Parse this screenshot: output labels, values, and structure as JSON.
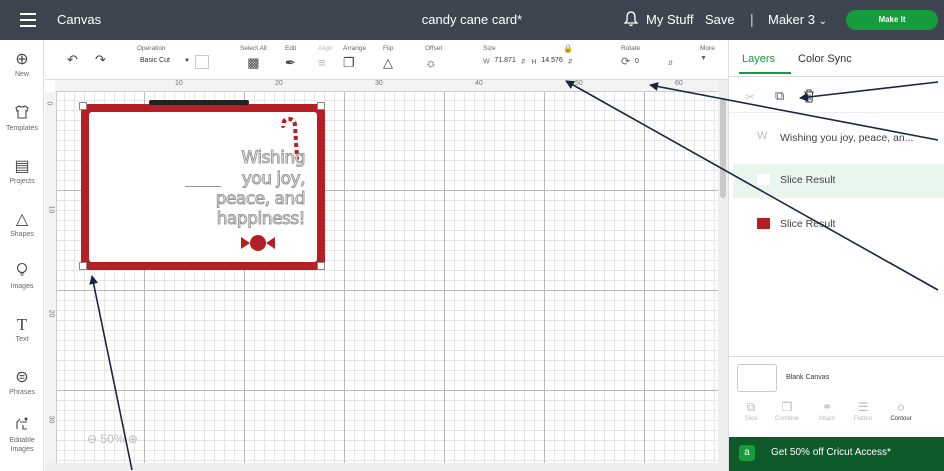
{
  "header": {
    "app_title": "Canvas",
    "doc_title": "candy cane card*",
    "my_stuff": "My Stuff",
    "save": "Save",
    "separator": "|",
    "machine": "Maker 3",
    "make_it": "Make It"
  },
  "sidebar": {
    "items": [
      {
        "icon": "⊕",
        "label": "New"
      },
      {
        "icon": "👕",
        "label": "Templates"
      },
      {
        "icon": "▤",
        "label": "Projects"
      },
      {
        "icon": "△",
        "label": "Shapes"
      },
      {
        "icon": "⚲",
        "label": "Images"
      },
      {
        "icon": "T",
        "label": "Text"
      },
      {
        "icon": "⊜",
        "label": "Phrases"
      },
      {
        "icon": "⬚",
        "label": "Editable Images"
      }
    ]
  },
  "toolbar": {
    "operation_label": "Operation",
    "operation_value": "Basic Cut",
    "select_all_label": "Select All",
    "edit_label": "Edit",
    "align_label": "Align",
    "arrange_label": "Arrange",
    "flip_label": "Flip",
    "offset_label": "Offset",
    "size_label": "Size",
    "width_prefix": "W",
    "width_value": "71.871",
    "height_prefix": "H",
    "height_value": "14.576",
    "rotate_label": "Rotate",
    "rotate_value": "0",
    "more_label": "More"
  },
  "ruler": {
    "top": [
      "10",
      "20",
      "30",
      "40",
      "50",
      "60"
    ],
    "left": [
      "0",
      "10",
      "20",
      "30"
    ]
  },
  "card": {
    "lines": [
      "Wishing",
      "you joy,",
      "peace, and",
      "happiness!"
    ]
  },
  "zoom": {
    "label": "50%"
  },
  "panel": {
    "tabs": [
      "Layers",
      "Color Sync"
    ],
    "layers": [
      {
        "label": "Wishing you joy, peace, an..."
      },
      {
        "label": "Slice Result"
      },
      {
        "label": "Slice Result"
      }
    ],
    "blank_canvas": "Blank Canvas",
    "tools": [
      "Slice",
      "Combine",
      "Attach",
      "Flatten",
      "Contour"
    ],
    "promo": "Get 50% off Cricut Access*"
  },
  "colors": {
    "header_bg": "#3d4650",
    "accent_green": "#169c3c",
    "card_red": "#b31f24",
    "promo_bg": "#0f5a2a"
  }
}
